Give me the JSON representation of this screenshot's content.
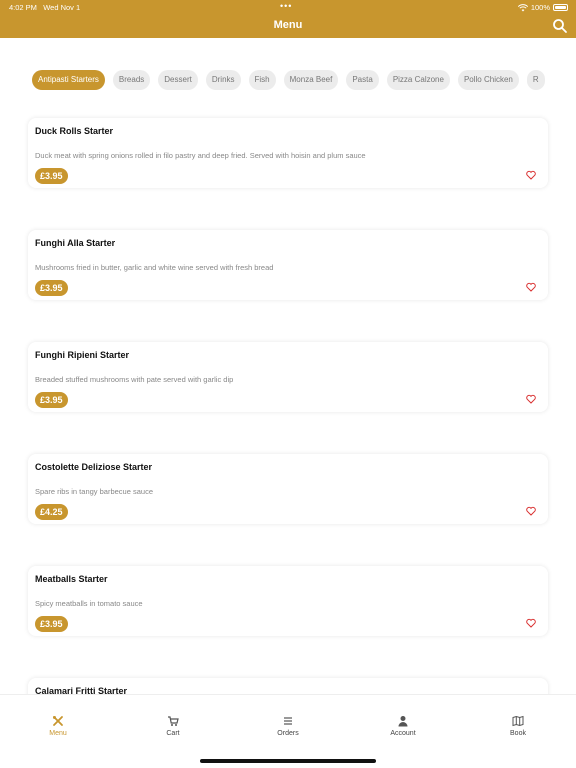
{
  "status": {
    "time": "4:02 PM",
    "date": "Wed Nov 1",
    "battery": "100%"
  },
  "header": {
    "title": "Menu"
  },
  "categories": [
    "Antipasti Starters",
    "Breads",
    "Dessert",
    "Drinks",
    "Fish",
    "Monza Beef",
    "Pasta",
    "Pizza Calzone",
    "Pollo Chicken",
    "R"
  ],
  "items": [
    {
      "name": "Duck Rolls Starter",
      "desc": "Duck meat with spring onions rolled in filo pastry and deep fried. Served with hoisin and plum sauce",
      "price": "£3.95"
    },
    {
      "name": "Funghi Alla Starter",
      "desc": "Mushrooms fried in butter, garlic and white wine served with fresh bread",
      "price": "£3.95"
    },
    {
      "name": "Funghi Ripieni Starter",
      "desc": "Breaded stuffed mushrooms with pate served with garlic dip",
      "price": "£3.95"
    },
    {
      "name": "Costolette Deliziose Starter",
      "desc": "Spare ribs in tangy barbecue sauce",
      "price": "£4.25"
    },
    {
      "name": "Meatballs Starter",
      "desc": "Spicy meatballs in tomato sauce",
      "price": "£3.95"
    },
    {
      "name": "Calamari Fritti Starter",
      "desc": "",
      "price": ""
    }
  ],
  "tabs": [
    "Menu",
    "Cart",
    "Orders",
    "Account",
    "Book"
  ],
  "colors": {
    "accent": "#c8962e",
    "heart": "#d93030"
  }
}
